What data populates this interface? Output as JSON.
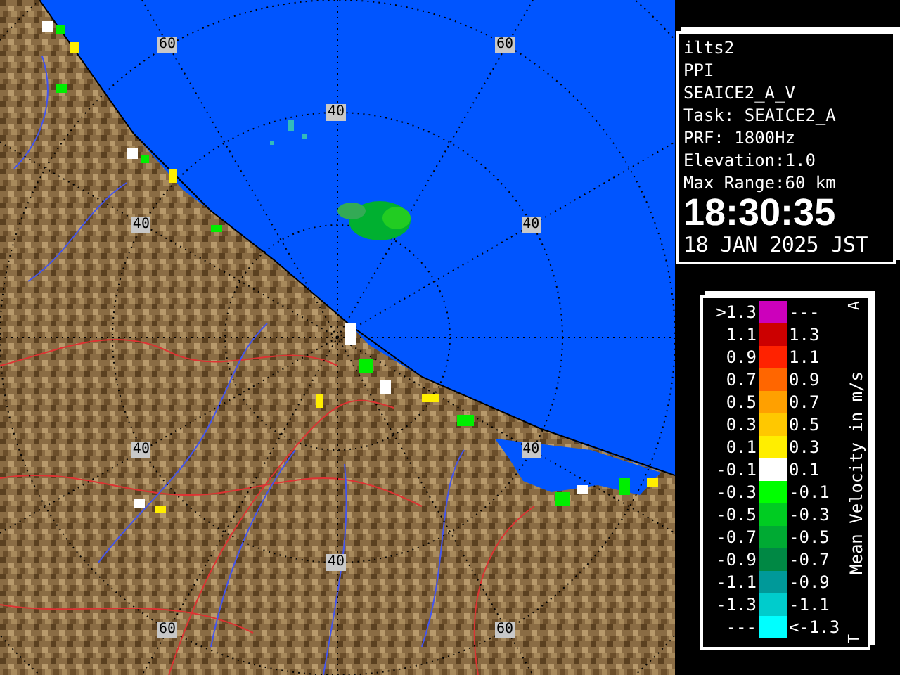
{
  "map": {
    "range_labels": [
      "60",
      "60",
      "40",
      "40",
      "40",
      "40",
      "40",
      "40",
      "60",
      "60"
    ]
  },
  "info": {
    "lines": [
      "ilts2",
      "PPI",
      "SEAICE2_A_V",
      "Task: SEAICE2_A",
      "PRF: 1800Hz",
      "Elevation:1.0",
      "Max Range:60 km"
    ],
    "time": "18:30:35",
    "date": "18 JAN 2025 JST"
  },
  "legend": {
    "title": "Mean Velocity in m/s",
    "top_mark": "A",
    "bottom_mark": "T",
    "rows": [
      {
        "low": ">1.3",
        "high": "---",
        "color": "#cc00bb"
      },
      {
        "low": "1.1",
        "high": "1.3",
        "color": "#cc0000"
      },
      {
        "low": "0.9",
        "high": "1.1",
        "color": "#ff2200"
      },
      {
        "low": "0.7",
        "high": "0.9",
        "color": "#ff6600"
      },
      {
        "low": "0.5",
        "high": "0.7",
        "color": "#ffa000"
      },
      {
        "low": "0.3",
        "high": "0.5",
        "color": "#ffc800"
      },
      {
        "low": "0.1",
        "high": "0.3",
        "color": "#ffee00"
      },
      {
        "low": "-0.1",
        "high": "0.1",
        "color": "#ffffff"
      },
      {
        "low": "-0.3",
        "high": "-0.1",
        "color": "#00ff00"
      },
      {
        "low": "-0.5",
        "high": "-0.3",
        "color": "#00cc22"
      },
      {
        "low": "-0.7",
        "high": "-0.5",
        "color": "#00aa33"
      },
      {
        "low": "-0.9",
        "high": "-0.7",
        "color": "#008844"
      },
      {
        "low": "-1.1",
        "high": "-0.9",
        "color": "#009999"
      },
      {
        "low": "-1.3",
        "high": "-1.1",
        "color": "#00cccc"
      },
      {
        "low": "---",
        "high": "<-1.3",
        "color": "#00ffff"
      }
    ]
  }
}
